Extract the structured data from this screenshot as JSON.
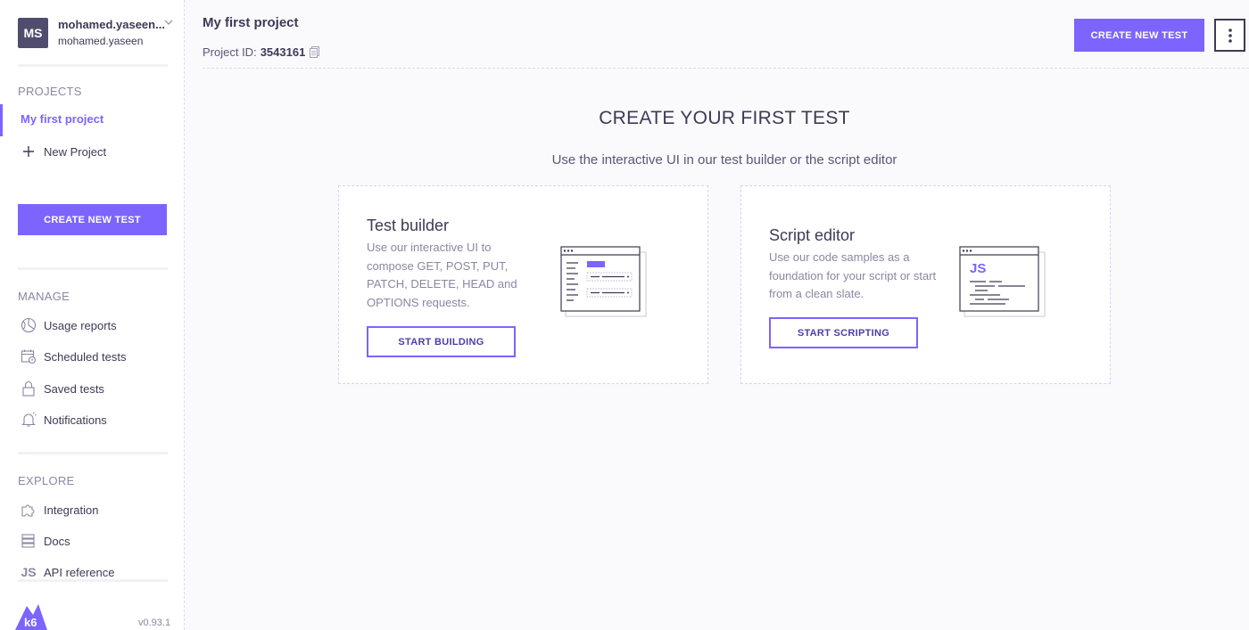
{
  "user": {
    "initials": "MS",
    "name": "mohamed.yaseen...",
    "sub": "mohamed.yaseen"
  },
  "sidebar": {
    "projects_label": "PROJECTS",
    "active_project": "My first project",
    "new_project": "New Project",
    "create_button": "CREATE NEW TEST",
    "manage_label": "MANAGE",
    "manage_items": [
      {
        "label": "Usage reports",
        "icon": "pie-chart-icon"
      },
      {
        "label": "Scheduled tests",
        "icon": "calendar-clock-icon"
      },
      {
        "label": "Saved tests",
        "icon": "lock-icon"
      },
      {
        "label": "Notifications",
        "icon": "bell-icon"
      }
    ],
    "explore_label": "EXPLORE",
    "explore_items": [
      {
        "label": "Integration",
        "icon": "puzzle-icon"
      },
      {
        "label": "Docs",
        "icon": "docs-stack-icon"
      },
      {
        "label": "API reference",
        "icon": "js-icon",
        "icon_text": "JS"
      }
    ],
    "version": "v0.93.1",
    "logo_text": "k6"
  },
  "header": {
    "title": "My first project",
    "project_id_label": "Project ID:",
    "project_id": "3543161",
    "create_button": "CREATE NEW TEST"
  },
  "main": {
    "title": "CREATE YOUR FIRST TEST",
    "subtitle": "Use the interactive UI in our test builder or the script editor",
    "cards": [
      {
        "title": "Test builder",
        "description": "Use our interactive UI to compose GET, POST, PUT, PATCH, DELETE, HEAD and OPTIONS requests.",
        "button": "START BUILDING"
      },
      {
        "title": "Script editor",
        "description": "Use our code samples as a foundation for your script or start from a clean slate.",
        "button": "START SCRIPTING",
        "illustration_text": "JS"
      }
    ]
  },
  "colors": {
    "accent": "#7d64ff",
    "text": "#3d3a55",
    "muted": "#8a87a3"
  }
}
